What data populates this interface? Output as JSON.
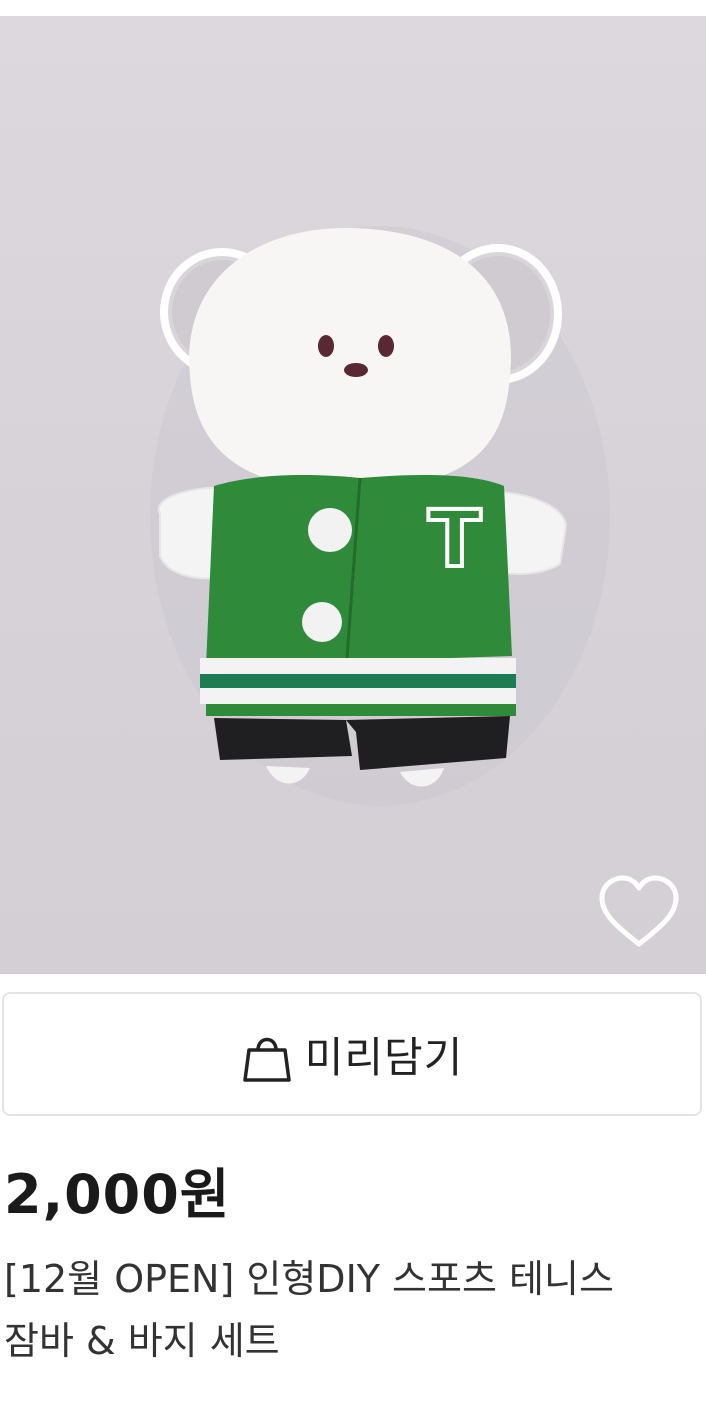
{
  "product": {
    "image_alt": "",
    "wishlist_icon": "heart-outline-icon",
    "cart_button": {
      "icon": "shopping-bag-icon",
      "label": "미리담기"
    },
    "price": "2,000원",
    "title": "[12월 OPEN] 인형DIY 스포츠 테니스 잠바 & 바지 세트"
  },
  "colors": {
    "background_photo": "#d8d4da",
    "jacket_green": "#2e8b3a",
    "text_dark": "#1a1a1a",
    "border": "#e4e4e4"
  }
}
